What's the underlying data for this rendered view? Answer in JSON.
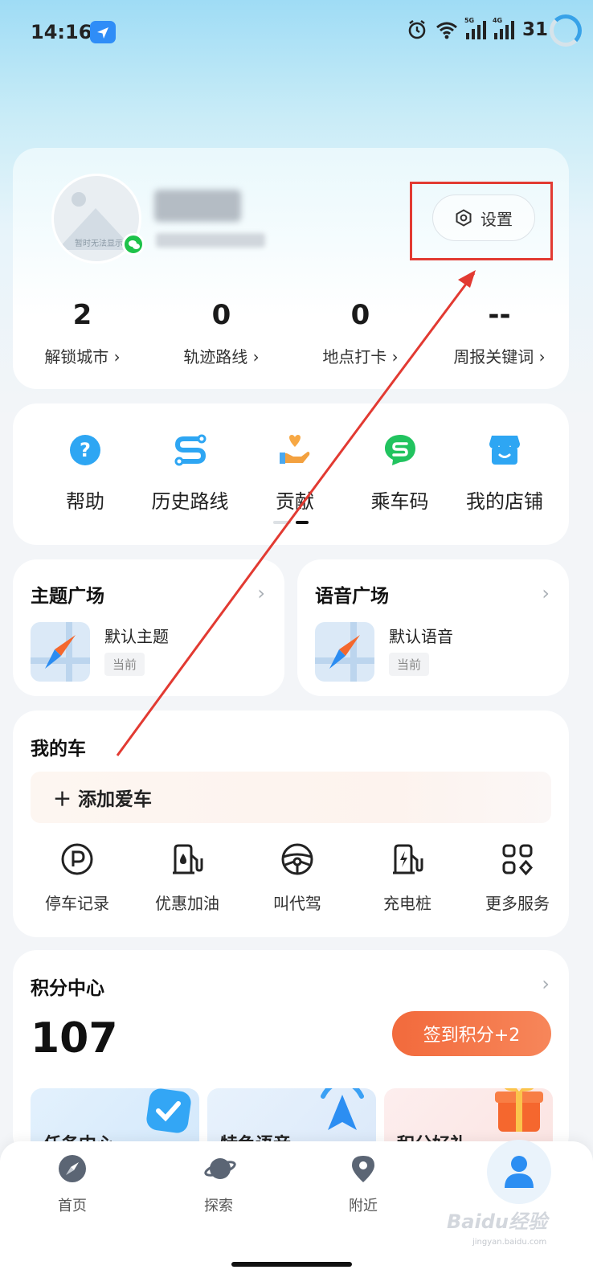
{
  "status_bar": {
    "time": "14:16",
    "battery": "31",
    "signal_1": "5G",
    "signal_2": "4G"
  },
  "profile": {
    "avatar_caption": "暂时无法显示",
    "settings_label": "设置",
    "stats": [
      {
        "value": "2",
        "label": "解锁城市 ›"
      },
      {
        "value": "0",
        "label": "轨迹路线 ›"
      },
      {
        "value": "0",
        "label": "地点打卡 ›"
      },
      {
        "value": "--",
        "label": "周报关键词 ›"
      }
    ]
  },
  "shortcuts": [
    {
      "label": "帮助",
      "icon": "help-icon"
    },
    {
      "label": "历史路线",
      "icon": "route-icon"
    },
    {
      "label": "贡献",
      "icon": "contribute-icon"
    },
    {
      "label": "乘车码",
      "icon": "ride-code-icon"
    },
    {
      "label": "我的店铺",
      "icon": "shop-icon"
    }
  ],
  "theme": {
    "title": "主题广场",
    "item_name": "默认主题",
    "tag": "当前"
  },
  "voice": {
    "title": "语音广场",
    "item_name": "默认语音",
    "tag": "当前"
  },
  "my_car": {
    "title": "我的车",
    "add_label": "＋ 添加爱车",
    "services": [
      {
        "label": "停车记录",
        "icon": "parking-icon"
      },
      {
        "label": "优惠加油",
        "icon": "fuel-icon"
      },
      {
        "label": "叫代驾",
        "icon": "steering-wheel-icon"
      },
      {
        "label": "充电桩",
        "icon": "charging-icon"
      },
      {
        "label": "更多服务",
        "icon": "more-services-icon"
      }
    ]
  },
  "points": {
    "title": "积分中心",
    "value": "107",
    "checkin_label": "签到积分+2",
    "cards": [
      "任务中心",
      "特色语音",
      "积分好礼"
    ]
  },
  "nav": [
    {
      "label": "首页",
      "icon": "compass-icon"
    },
    {
      "label": "探索",
      "icon": "planet-icon"
    },
    {
      "label": "附近",
      "icon": "location-pin-icon"
    },
    {
      "label": "",
      "icon": "user-icon"
    }
  ],
  "watermark": {
    "brand": "Baidu经验",
    "domain": "jingyan.baidu.com"
  },
  "colors": {
    "accent": "#2f8df7",
    "highlight": "#e23a32",
    "checkin": "#f26a3c"
  }
}
